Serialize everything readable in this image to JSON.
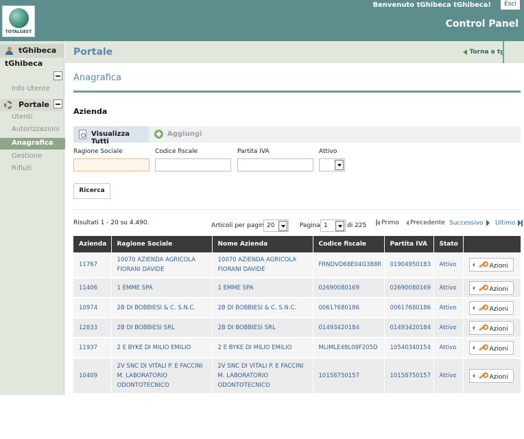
{
  "header": {
    "logo_text": "TOTALGEST",
    "welcome": "Benvenuto tGhibeca tGhibeca!",
    "logout": "Esci",
    "control_panel": "Control Panel"
  },
  "sidebar": {
    "user": "tGhibeca",
    "group": "tGhibeca",
    "info_utente": "Info Utente",
    "portale": "Portale",
    "items": [
      "Utenti",
      "Autorizzazioni",
      "Anagrafica",
      "Gestione",
      "Rifiuti"
    ],
    "active_item": "Anagrafica"
  },
  "topbar": {
    "title": "Portale",
    "back_link": "Torna a tgoo"
  },
  "page": {
    "section_title": "Anagrafica",
    "entity_title": "Azienda",
    "btn_view_all": "Visualizza Tutti",
    "btn_add": "Aggiungi"
  },
  "filters": {
    "ragione_sociale": {
      "label": "Ragione Sociale",
      "value": ""
    },
    "codice_fiscale": {
      "label": "Codice fiscale",
      "value": ""
    },
    "partita_iva": {
      "label": "Partita IVA",
      "value": ""
    },
    "attivo": {
      "label": "Attivo",
      "value": ""
    },
    "search_button": "Ricerca"
  },
  "pagination": {
    "results": "Risultati 1 - 20 su 4.490.",
    "per_page_label": "Articoli per pagina",
    "per_page_value": "20",
    "page_label": "Pagina",
    "page_value": "1",
    "page_of": "di 225",
    "first": "Primo",
    "previous": "Precedente",
    "next": "Successivo",
    "last": "Ultimo"
  },
  "table": {
    "columns": [
      "Azienda",
      "Ragione Sociale",
      "Nome Azienda",
      "Codice fiscale",
      "Partita IVA",
      "Stato",
      ""
    ],
    "action_label": "Azioni",
    "rows": [
      {
        "id": "11767",
        "ragione": "10070 AZIENDA AGRICOLA FIORANI DAVIDE",
        "nome": "10070 AZIENDA AGRICOLA FIORANI DAVIDE",
        "cf": "FRNDVD68E04G388R",
        "piva": "01904950183",
        "stato": "Attivo"
      },
      {
        "id": "11406",
        "ragione": "1 EMME SPA",
        "nome": "1 EMME SPA",
        "cf": "02690080169",
        "piva": "02690080169",
        "stato": "Attivo"
      },
      {
        "id": "10974",
        "ragione": "2B DI BOBBIESI & C. S.N.C.",
        "nome": "2B DI BOBBIESI & C. S.N.C.",
        "cf": "00617680186",
        "piva": "00617680186",
        "stato": "Attivo"
      },
      {
        "id": "12833",
        "ragione": "2B DI BOBBIESI SRL",
        "nome": "2B DI BOBBIESI SRL",
        "cf": "01493420184",
        "piva": "01493420184",
        "stato": "Attivo"
      },
      {
        "id": "11937",
        "ragione": "2 E BYKE DI MILIO EMILIO",
        "nome": "2 E BYKE DI MILIO EMILIO",
        "cf": "MLIMLE48L09F205D",
        "piva": "10540340154",
        "stato": "Attivo"
      },
      {
        "id": "10409",
        "ragione": "2V SNC DI VITALI P. E FACCINI M. LABORATORIO ODONTOTECNICO",
        "nome": "2V SNC DI VITALI P. E FACCINI M. LABORATORIO ODONTOTECNICO",
        "cf": "10158750157",
        "piva": "10158750157",
        "stato": "Attivo"
      }
    ]
  }
}
